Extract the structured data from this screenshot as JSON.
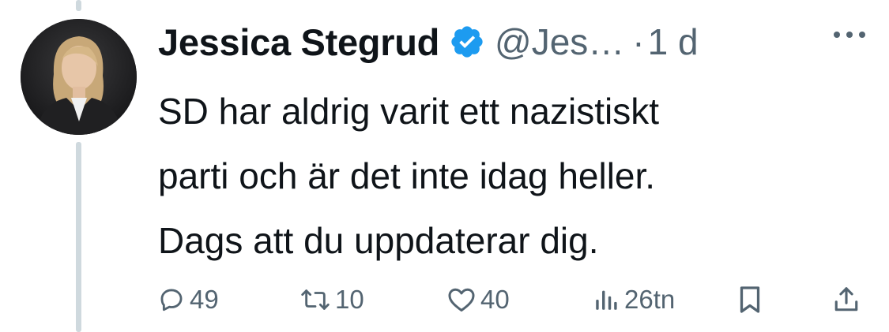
{
  "author": {
    "display_name": "Jessica Stegrud",
    "handle": "@Jes…",
    "separator": "·",
    "time": "1 d",
    "verified_color": "#1d9bf0"
  },
  "tweet": {
    "text": "SD har aldrig varit ett nazistiskt\nparti och är det inte idag heller.\nDags att du uppdaterar dig."
  },
  "actions": {
    "reply_count": "49",
    "retweet_count": "10",
    "like_count": "40",
    "views_count": "26tn"
  },
  "icons": {
    "reply": "reply-icon",
    "retweet": "retweet-icon",
    "like": "heart-icon",
    "views": "views-icon",
    "bookmark": "bookmark-icon",
    "share": "share-icon",
    "more": "more-icon",
    "verified": "verified-badge-icon"
  },
  "colors": {
    "text_primary": "#0f1419",
    "text_secondary": "#536471",
    "thread_line": "#cfd9de"
  }
}
